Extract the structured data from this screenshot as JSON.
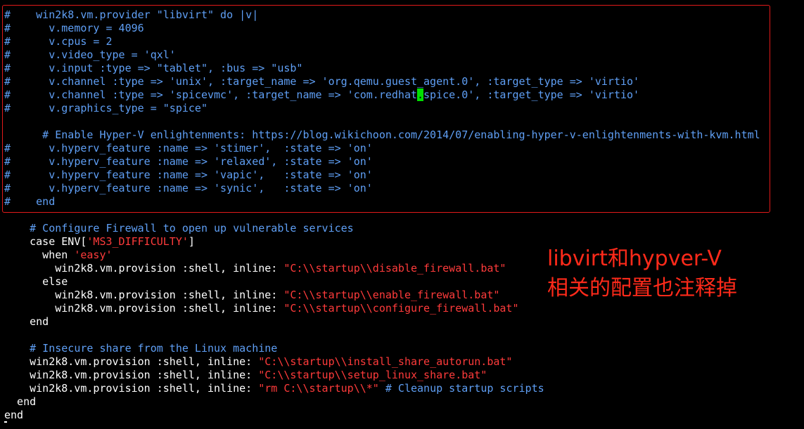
{
  "lines": [
    [
      {
        "t": "#    win2k8.vm.provider \"libvirt\" do |v|",
        "c": "comment"
      }
    ],
    [
      {
        "t": "#      v.memory = 4096",
        "c": "comment"
      }
    ],
    [
      {
        "t": "#      v.cpus = 2",
        "c": "comment"
      }
    ],
    [
      {
        "t": "#      v.video_type = 'qxl'",
        "c": "comment"
      }
    ],
    [
      {
        "t": "#      v.input :type => \"tablet\", :bus => \"usb\"",
        "c": "comment"
      }
    ],
    [
      {
        "t": "#      v.channel :type => 'unix', :target_name => 'org.qemu.guest_agent.0', :target_type => 'virtio'",
        "c": "comment"
      }
    ],
    [
      {
        "t": "#      v.channel :type => 'spicevmc', :target_name => 'com.redhat",
        "c": "comment"
      },
      {
        "t": ".",
        "c": "cursor"
      },
      {
        "t": "spice.0', :target_type => 'virtio'",
        "c": "comment"
      }
    ],
    [
      {
        "t": "#      v.graphics_type = \"spice\"",
        "c": "comment"
      }
    ],
    [
      {
        "t": "",
        "c": "text"
      }
    ],
    [
      {
        "t": "      # Enable Hyper-V enlightenments: https://blog.wikichoon.com/2014/07/enabling-hyper-v-enlightenments-with-kvm.html",
        "c": "comment"
      }
    ],
    [
      {
        "t": "#      v.hyperv_feature :name => 'stimer',  :state => 'on'",
        "c": "comment"
      }
    ],
    [
      {
        "t": "#      v.hyperv_feature :name => 'relaxed', :state => 'on'",
        "c": "comment"
      }
    ],
    [
      {
        "t": "#      v.hyperv_feature :name => 'vapic',   :state => 'on'",
        "c": "comment"
      }
    ],
    [
      {
        "t": "#      v.hyperv_feature :name => 'synic',   :state => 'on'",
        "c": "comment"
      }
    ],
    [
      {
        "t": "#    end",
        "c": "comment"
      }
    ],
    [
      {
        "t": "",
        "c": "text"
      }
    ],
    [
      {
        "t": "    # Configure Firewall to open up vulnerable services",
        "c": "comment"
      }
    ],
    [
      {
        "t": "    case ENV[",
        "c": "text"
      },
      {
        "t": "'MS3_DIFFICULTY'",
        "c": "string"
      },
      {
        "t": "]",
        "c": "text"
      }
    ],
    [
      {
        "t": "      when ",
        "c": "text"
      },
      {
        "t": "'easy'",
        "c": "string"
      }
    ],
    [
      {
        "t": "        win2k8.vm.provision :shell, inline: ",
        "c": "text"
      },
      {
        "t": "\"C:\\\\startup\\\\disable_firewall.bat\"",
        "c": "string"
      }
    ],
    [
      {
        "t": "      else",
        "c": "text"
      }
    ],
    [
      {
        "t": "        win2k8.vm.provision :shell, inline: ",
        "c": "text"
      },
      {
        "t": "\"C:\\\\startup\\\\enable_firewall.bat\"",
        "c": "string"
      }
    ],
    [
      {
        "t": "        win2k8.vm.provision :shell, inline: ",
        "c": "text"
      },
      {
        "t": "\"C:\\\\startup\\\\configure_firewall.bat\"",
        "c": "string"
      }
    ],
    [
      {
        "t": "    end",
        "c": "text"
      }
    ],
    [
      {
        "t": "",
        "c": "text"
      }
    ],
    [
      {
        "t": "    # Insecure share from the Linux machine",
        "c": "comment"
      }
    ],
    [
      {
        "t": "    win2k8.vm.provision :shell, inline: ",
        "c": "text"
      },
      {
        "t": "\"C:\\\\startup\\\\install_share_autorun.bat\"",
        "c": "string"
      }
    ],
    [
      {
        "t": "    win2k8.vm.provision :shell, inline: ",
        "c": "text"
      },
      {
        "t": "\"C:\\\\startup\\\\setup_linux_share.bat\"",
        "c": "string"
      }
    ],
    [
      {
        "t": "    win2k8.vm.provision :shell, inline: ",
        "c": "text"
      },
      {
        "t": "\"rm C:\\\\startup\\\\*\"",
        "c": "string"
      },
      {
        "t": " # Cleanup startup scripts",
        "c": "comment"
      }
    ],
    [
      {
        "t": "  end",
        "c": "text"
      }
    ],
    [
      {
        "t": "end",
        "c": "text"
      }
    ]
  ],
  "annotation": {
    "line1": "libvirt和hypver-V",
    "line2": "相关的配置也注释掉"
  },
  "colors": {
    "background": "#000000",
    "comment": "#5f9ff5",
    "string": "#ff3b3b",
    "text": "#ffffff",
    "cursor": "#00e000",
    "highlight_border": "#e21a1a",
    "annotation": "#ff2a1a"
  }
}
